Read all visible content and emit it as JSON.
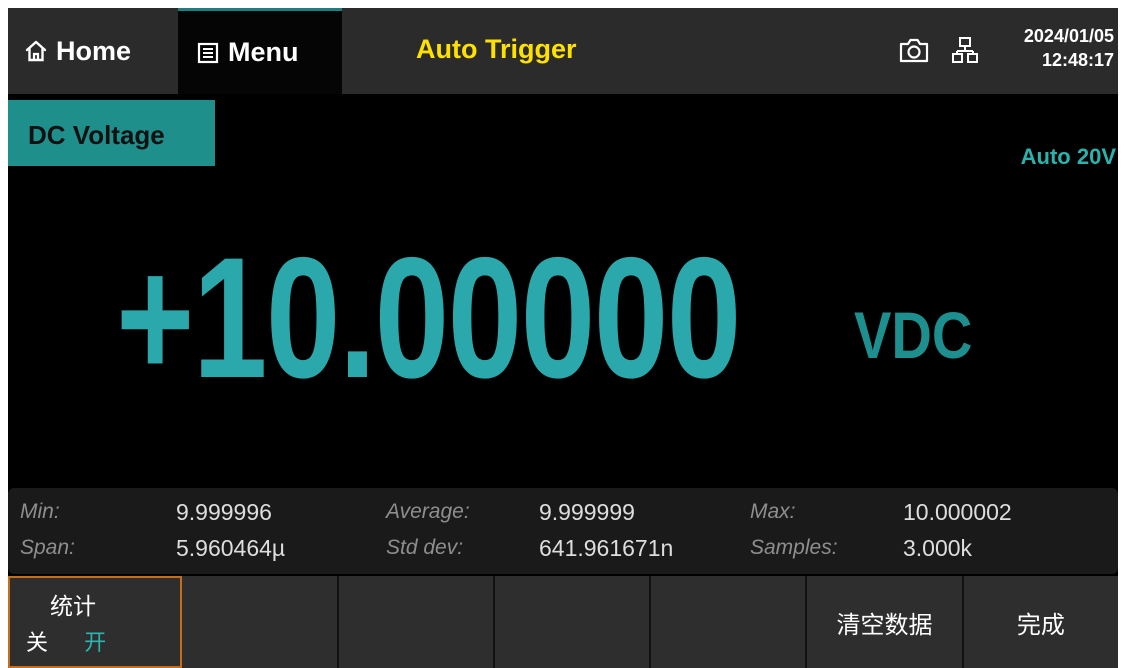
{
  "topbar": {
    "home_label": "Home",
    "menu_label": "Menu",
    "trigger_mode": "Auto Trigger",
    "date": "2024/01/05",
    "time": "12:48:17",
    "icons": [
      "home-icon",
      "menu-icon",
      "camera-icon",
      "network-icon"
    ]
  },
  "measurement": {
    "function": "DC Voltage",
    "range": "Auto 20V",
    "reading": "+10.00000",
    "unit": "VDC"
  },
  "stats": {
    "min_label": "Min:",
    "min_value": "9.999996",
    "average_label": "Average:",
    "average_value": "9.999999",
    "max_label": "Max:",
    "max_value": "10.000002",
    "span_label": "Span:",
    "span_value": "5.960464µ",
    "stddev_label": "Std dev:",
    "stddev_value": "641.961671n",
    "samples_label": "Samples:",
    "samples_value": "3.000k"
  },
  "softkeys": {
    "stats_title": "统计",
    "stats_off": "关",
    "stats_on": "开",
    "stats_selected": "开",
    "clear_data": "清空数据",
    "done": "完成"
  },
  "colors": {
    "accent_teal": "#2aa8ab",
    "trigger_yellow": "#ffe100",
    "selected_border": "#c76e1c"
  }
}
